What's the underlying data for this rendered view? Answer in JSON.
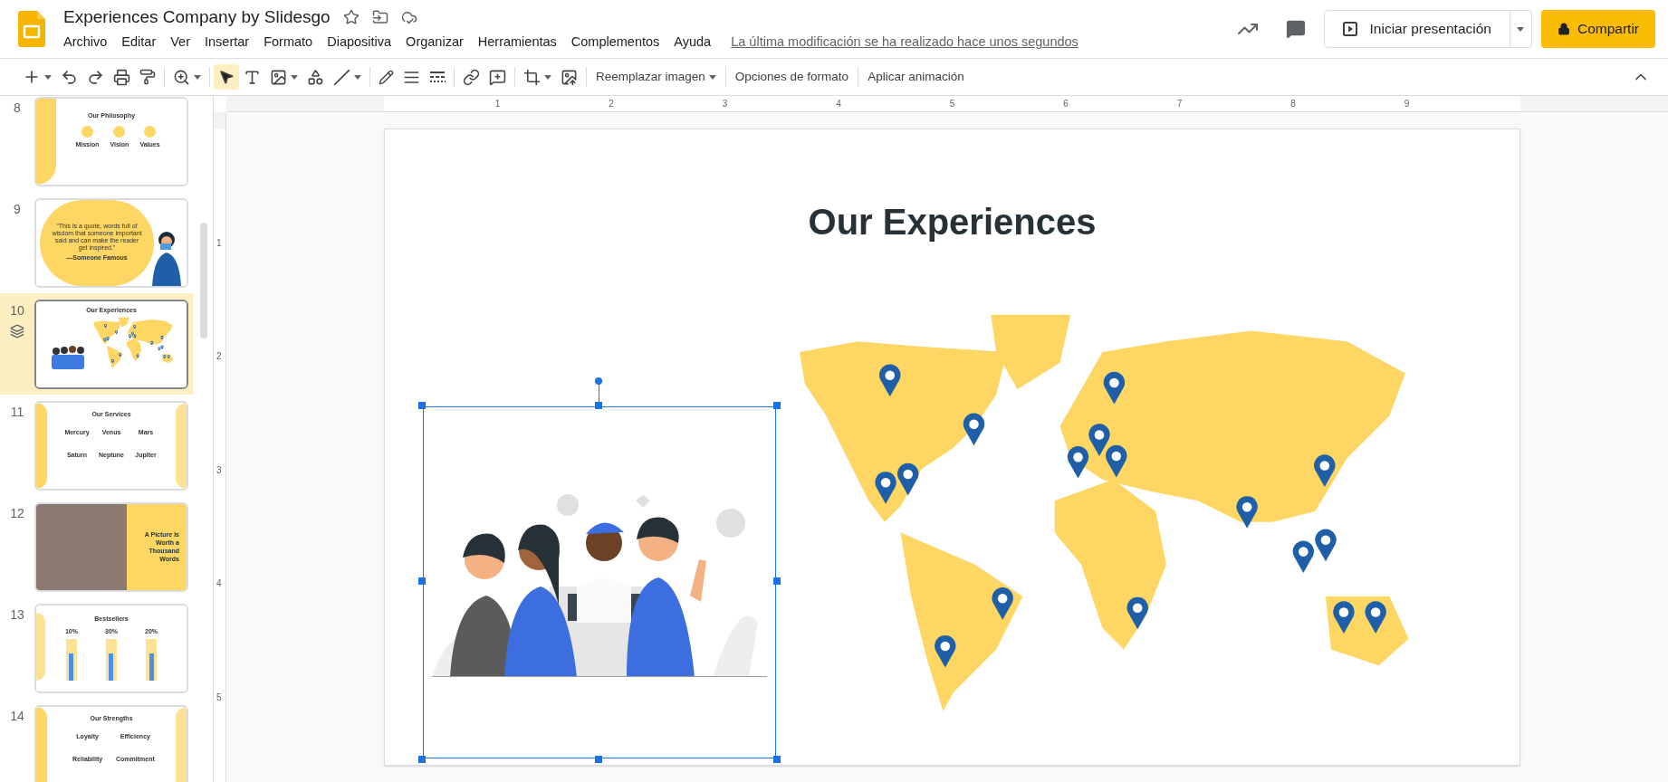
{
  "document": {
    "title": "Experiences Company by Slidesgo",
    "last_edit": "La última modificación se ha realizado hace unos segundos"
  },
  "menu": [
    "Archivo",
    "Editar",
    "Ver",
    "Insertar",
    "Formato",
    "Diapositiva",
    "Organizar",
    "Herramientas",
    "Complementos",
    "Ayuda"
  ],
  "header_buttons": {
    "present": "Iniciar presentación",
    "share": "Compartir"
  },
  "toolbar": {
    "pointer_selected": true,
    "text_buttons": [
      {
        "label": "Reemplazar imagen",
        "kind": "dropdown"
      },
      {
        "label": "Opciones de formato",
        "kind": "plain"
      },
      {
        "label": "Aplicar animación",
        "kind": "plain"
      }
    ]
  },
  "ruler": {
    "horizontal": [
      "1",
      "2",
      "3",
      "4",
      "5",
      "6",
      "7",
      "8",
      "9"
    ],
    "vertical": [
      "1",
      "2",
      "3",
      "4",
      "5"
    ]
  },
  "slides": [
    {
      "number": "8",
      "kind": "columns",
      "selected": false,
      "animated": false,
      "title": "Our Philosophy",
      "items": [
        "Mission",
        "Vision",
        "Values"
      ]
    },
    {
      "number": "9",
      "kind": "quote",
      "selected": false,
      "animated": false,
      "quote": "“This is a quote, words full of wisdom that someone important said and can make the reader get inspired.”",
      "author": "—Someone Famous"
    },
    {
      "number": "10",
      "kind": "map",
      "selected": true,
      "animated": true,
      "title": "Our Experiences"
    },
    {
      "number": "11",
      "kind": "grid",
      "selected": false,
      "animated": false,
      "title": "Our Services",
      "items": [
        "Mercury",
        "Venus",
        "Mars",
        "Saturn",
        "Neptune",
        "Jupiter"
      ]
    },
    {
      "number": "12",
      "kind": "photo",
      "selected": false,
      "animated": false,
      "title": "A Picture Is Worth a Thousand Words"
    },
    {
      "number": "13",
      "kind": "bars",
      "selected": false,
      "animated": false,
      "title": "Bestsellers",
      "items": [
        "10%",
        "30%",
        "20%"
      ]
    },
    {
      "number": "14",
      "kind": "grid",
      "selected": false,
      "animated": false,
      "title": "Our Strengths",
      "items": [
        "Loyalty",
        "Efficiency",
        "Reliability",
        "Commitment"
      ]
    }
  ],
  "canvas": {
    "title": "Our Experiences",
    "image_selected": true
  }
}
